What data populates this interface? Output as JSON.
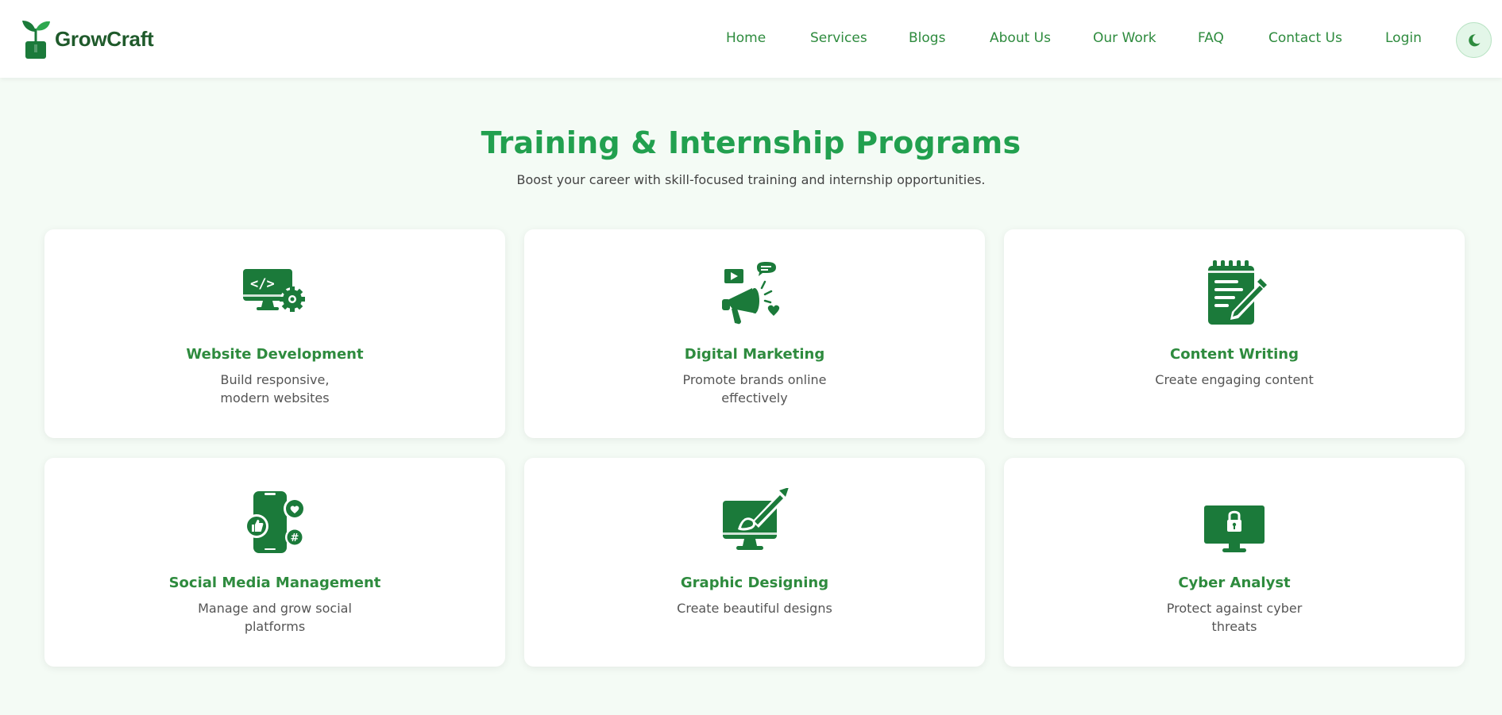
{
  "brand": {
    "name": "GrowCraft",
    "logo_icon": "sprout-logo-icon",
    "color": "#1f5a2b"
  },
  "nav": {
    "items": [
      {
        "label": "Home"
      },
      {
        "label": "Services"
      },
      {
        "label": "Blogs"
      },
      {
        "label": "About Us"
      },
      {
        "label": "Our Work"
      },
      {
        "label": "FAQ"
      },
      {
        "label": "Contact Us"
      },
      {
        "label": "Login"
      }
    ],
    "theme_toggle_icon": "moon-icon"
  },
  "hero": {
    "title": "Training & Internship Programs",
    "subtitle": "Boost your career with skill-focused training and internship opportunities."
  },
  "programs": [
    {
      "title": "Website Development",
      "description": "Build responsive, modern websites",
      "icon": "web-development-icon"
    },
    {
      "title": "Digital Marketing",
      "description": "Promote brands online effectively",
      "icon": "megaphone-icon"
    },
    {
      "title": "Content Writing",
      "description": "Create engaging content",
      "icon": "notepad-pen-icon"
    },
    {
      "title": "Social Media Management",
      "description": "Manage and grow social platforms",
      "icon": "social-phone-icon"
    },
    {
      "title": "Graphic Designing",
      "description": "Create beautiful designs",
      "icon": "design-monitor-icon"
    },
    {
      "title": "Cyber Analyst",
      "description": "Protect against cyber threats",
      "icon": "lock-monitor-icon"
    }
  ],
  "colors": {
    "accent": "#22a04f",
    "icon_green": "#1b7a3a",
    "background": "#f4fbf5"
  }
}
